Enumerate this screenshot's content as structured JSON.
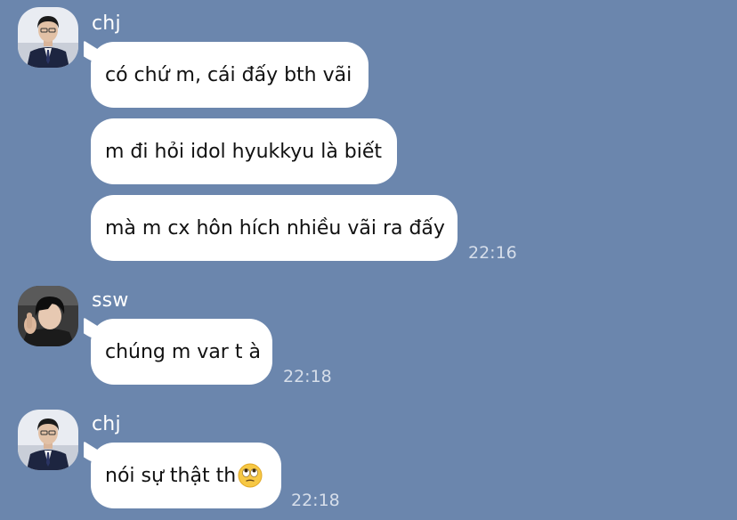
{
  "theme": {
    "background": "#6b86ad",
    "bubble": "#ffffff",
    "sender_text": "#ffffff",
    "time_text": "#d6deea"
  },
  "messages": [
    {
      "sender": "chj",
      "avatar": "person-in-suit-avatar",
      "bubbles": [
        "có chứ m, cái đấy bth vãi",
        "m đi hỏi idol hyukkyu là biết",
        "mà m cx hôn hích nhiều vãi ra đấy"
      ],
      "time": "22:16"
    },
    {
      "sender": "ssw",
      "avatar": "dark-hair-person-avatar",
      "bubbles": [
        "chúng m var t à"
      ],
      "time": "22:18"
    },
    {
      "sender": "chj",
      "avatar": "person-in-suit-avatar",
      "bubbles": [
        "nói sự thật th"
      ],
      "emoji": "rolling-eyes-emoji",
      "time": "22:18"
    }
  ]
}
